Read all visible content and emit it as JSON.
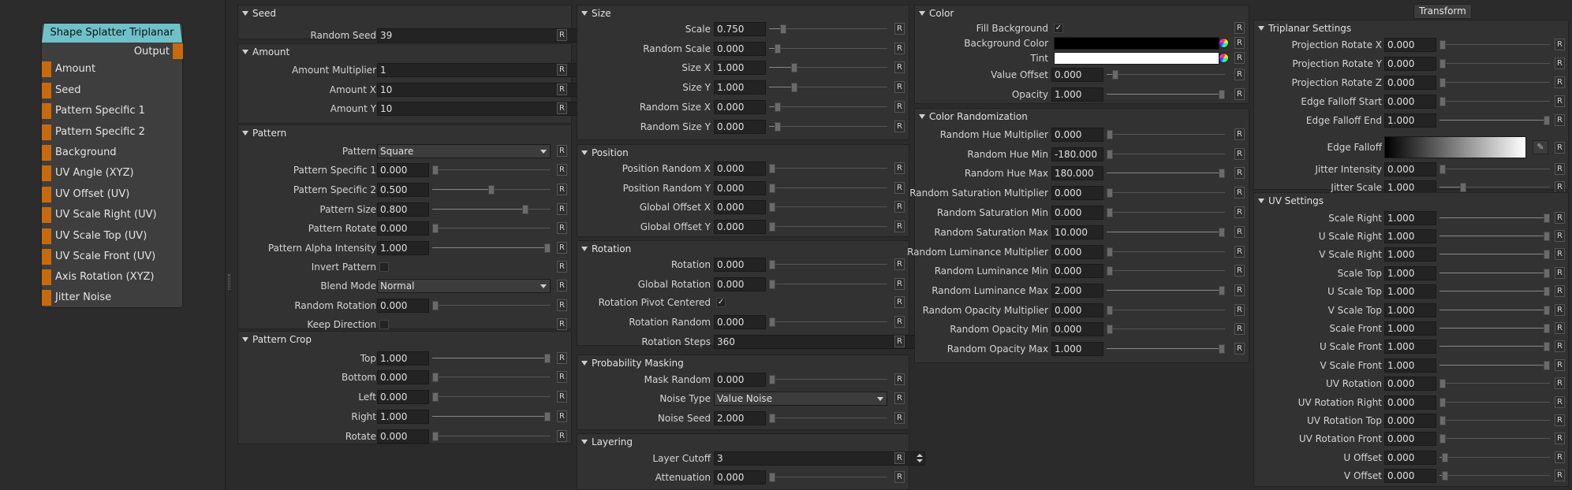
{
  "node": {
    "title": "Shape Splatter Triplanar",
    "output": "Output",
    "inputs": [
      "Amount",
      "Seed",
      "Pattern Specific 1",
      "Pattern Specific 2",
      "Background",
      "UV Angle (XYZ)",
      "UV Offset (UV)",
      "UV Scale Right (UV)",
      "UV Scale Top (UV)",
      "UV Scale Front (UV)",
      "Axis Rotation (XYZ)",
      "Jitter Noise"
    ]
  },
  "reset_label": "R",
  "check_mark": "✓",
  "edit_icon": "✎",
  "transform_tab": "Transform",
  "colors": {
    "node_header": "#6ec1c9",
    "port": "#c86a0c",
    "background_color": "#000000",
    "tint": "#ffffff"
  },
  "panels": [
    {
      "id": "seed",
      "title": "Seed",
      "rows": [
        {
          "label": "Random Seed",
          "type": "spin",
          "value": "39"
        }
      ]
    },
    {
      "id": "amount",
      "title": "Amount",
      "rows": [
        {
          "label": "Amount Multiplier",
          "type": "spin",
          "value": "1"
        },
        {
          "label": "Amount X",
          "type": "spin",
          "value": "10"
        },
        {
          "label": "Amount Y",
          "type": "spin",
          "value": "10"
        }
      ]
    },
    {
      "id": "pattern",
      "title": "Pattern",
      "rows": [
        {
          "label": "Pattern",
          "type": "dropdown",
          "value": "Square"
        },
        {
          "label": "Pattern Specific 1",
          "type": "slider",
          "value": "0.000",
          "level": 0
        },
        {
          "label": "Pattern Specific 2",
          "type": "slider",
          "value": "0.500",
          "level": 0.5
        },
        {
          "label": "Pattern Size",
          "type": "slider",
          "value": "0.800",
          "level": 0.8
        },
        {
          "label": "Pattern Rotate",
          "type": "slider",
          "value": "0.000",
          "level": 0
        },
        {
          "label": "Pattern Alpha Intensity",
          "type": "slider",
          "value": "1.000",
          "level": 1
        },
        {
          "label": "Invert Pattern",
          "type": "check",
          "checked": false
        },
        {
          "label": "Blend Mode",
          "type": "dropdown",
          "value": "Normal"
        },
        {
          "label": "Random Rotation",
          "type": "slider",
          "value": "0.000",
          "level": 0
        },
        {
          "label": "Keep Direction",
          "type": "check",
          "checked": false
        }
      ]
    },
    {
      "id": "pattern-crop",
      "title": "Pattern Crop",
      "rows": [
        {
          "label": "Top",
          "type": "slider",
          "value": "1.000",
          "level": 1
        },
        {
          "label": "Bottom",
          "type": "slider",
          "value": "0.000",
          "level": 0
        },
        {
          "label": "Left",
          "type": "slider",
          "value": "0.000",
          "level": 0
        },
        {
          "label": "Right",
          "type": "slider",
          "value": "1.000",
          "level": 1
        },
        {
          "label": "Rotate",
          "type": "slider",
          "value": "0.000",
          "level": 0
        }
      ]
    },
    {
      "id": "size",
      "title": "Size",
      "rows": [
        {
          "label": "Scale",
          "type": "slider",
          "value": "0.750",
          "level": 0.1
        },
        {
          "label": "Random Scale",
          "type": "slider",
          "value": "0.000",
          "level": 0.05
        },
        {
          "label": "Size X",
          "type": "slider",
          "value": "1.000",
          "level": 0.2
        },
        {
          "label": "Size Y",
          "type": "slider",
          "value": "1.000",
          "level": 0.2
        },
        {
          "label": "Random Size X",
          "type": "slider",
          "value": "0.000",
          "level": 0.05
        },
        {
          "label": "Random Size Y",
          "type": "slider",
          "value": "0.000",
          "level": 0.05
        }
      ]
    },
    {
      "id": "position",
      "title": "Position",
      "rows": [
        {
          "label": "Position Random X",
          "type": "slider",
          "value": "0.000",
          "level": 0
        },
        {
          "label": "Position Random Y",
          "type": "slider",
          "value": "0.000",
          "level": 0
        },
        {
          "label": "Global Offset X",
          "type": "slider",
          "value": "0.000",
          "level": 0
        },
        {
          "label": "Global Offset Y",
          "type": "slider",
          "value": "0.000",
          "level": 0
        }
      ]
    },
    {
      "id": "rotation",
      "title": "Rotation",
      "rows": [
        {
          "label": "Rotation",
          "type": "slider",
          "value": "0.000",
          "level": 0
        },
        {
          "label": "Global Rotation",
          "type": "slider",
          "value": "0.000",
          "level": 0
        },
        {
          "label": "Rotation Pivot Centered",
          "type": "check",
          "checked": true
        },
        {
          "label": "Rotation Random",
          "type": "slider",
          "value": "0.000",
          "level": 0
        },
        {
          "label": "Rotation Steps",
          "type": "spin",
          "value": "360"
        }
      ]
    },
    {
      "id": "probability",
      "title": "Probability Masking",
      "rows": [
        {
          "label": "Mask Random",
          "type": "slider",
          "value": "0.000",
          "level": 0
        },
        {
          "label": "Noise Type",
          "type": "dropdown",
          "value": "Value Noise"
        },
        {
          "label": "Noise Seed",
          "type": "slider",
          "value": "2.000",
          "level": 0
        }
      ]
    },
    {
      "id": "layering",
      "title": "Layering",
      "rows": [
        {
          "label": "Layer Cutoff",
          "type": "spin",
          "value": "3"
        },
        {
          "label": "Attenuation",
          "type": "slider",
          "value": "0.000",
          "level": 0
        }
      ]
    },
    {
      "id": "color",
      "title": "Color",
      "rows": [
        {
          "label": "Fill Background",
          "type": "check",
          "checked": true
        },
        {
          "label": "Background Color",
          "type": "color",
          "color": "#000000"
        },
        {
          "label": "Tint",
          "type": "color",
          "color": "#ffffff"
        },
        {
          "label": "Value Offset",
          "type": "slider",
          "value": "0.000",
          "level": 0.05
        },
        {
          "label": "Opacity",
          "type": "slider",
          "value": "1.000",
          "level": 1
        }
      ]
    },
    {
      "id": "color-rand",
      "title": "Color Randomization",
      "rows": [
        {
          "label": "Random Hue Multiplier",
          "type": "slider",
          "value": "0.000",
          "level": 0
        },
        {
          "label": "Random Hue Min",
          "type": "slider",
          "value": "-180.000",
          "level": 0
        },
        {
          "label": "Random Hue Max",
          "type": "slider",
          "value": "180.000",
          "level": 1
        },
        {
          "label": "Random Saturation Multiplier",
          "type": "slider",
          "value": "0.000",
          "level": 0
        },
        {
          "label": "Random Saturation Min",
          "type": "slider",
          "value": "0.000",
          "level": 0
        },
        {
          "label": "Random Saturation Max",
          "type": "slider",
          "value": "10.000",
          "level": 1
        },
        {
          "label": "Random Luminance Multiplier",
          "type": "slider",
          "value": "0.000",
          "level": 0
        },
        {
          "label": "Random Luminance Min",
          "type": "slider",
          "value": "0.000",
          "level": 0
        },
        {
          "label": "Random Luminance Max",
          "type": "slider",
          "value": "2.000",
          "level": 1
        },
        {
          "label": "Random Opacity Multiplier",
          "type": "slider",
          "value": "0.000",
          "level": 0
        },
        {
          "label": "Random Opacity Min",
          "type": "slider",
          "value": "0.000",
          "level": 0
        },
        {
          "label": "Random Opacity Max",
          "type": "slider",
          "value": "1.000",
          "level": 1
        }
      ]
    },
    {
      "id": "triplanar",
      "title": "Triplanar Settings",
      "rows": [
        {
          "label": "Projection Rotate X",
          "type": "slider",
          "value": "0.000",
          "level": 0
        },
        {
          "label": "Projection Rotate Y",
          "type": "slider",
          "value": "0.000",
          "level": 0
        },
        {
          "label": "Projection Rotate Z",
          "type": "slider",
          "value": "0.000",
          "level": 0
        },
        {
          "label": "Edge Falloff Start",
          "type": "slider",
          "value": "0.000",
          "level": 0
        },
        {
          "label": "Edge Falloff End",
          "type": "slider",
          "value": "1.000",
          "level": 1
        },
        {
          "label": "Edge Falloff",
          "type": "gradient"
        },
        {
          "label": "Jitter Intensity",
          "type": "slider",
          "value": "0.000",
          "level": 0
        },
        {
          "label": "Jitter Scale",
          "type": "slider",
          "value": "1.000",
          "level": 0.2
        }
      ]
    },
    {
      "id": "uv",
      "title": "UV Settings",
      "rows": [
        {
          "label": "Scale Right",
          "type": "slider",
          "value": "1.000",
          "level": 1
        },
        {
          "label": "U Scale Right",
          "type": "slider",
          "value": "1.000",
          "level": 1
        },
        {
          "label": "V Scale Right",
          "type": "slider",
          "value": "1.000",
          "level": 1
        },
        {
          "label": "Scale Top",
          "type": "slider",
          "value": "1.000",
          "level": 1
        },
        {
          "label": "U Scale Top",
          "type": "slider",
          "value": "1.000",
          "level": 1
        },
        {
          "label": "V Scale Top",
          "type": "slider",
          "value": "1.000",
          "level": 1
        },
        {
          "label": "Scale Front",
          "type": "slider",
          "value": "1.000",
          "level": 1
        },
        {
          "label": "U Scale Front",
          "type": "slider",
          "value": "1.000",
          "level": 1
        },
        {
          "label": "V Scale Front",
          "type": "slider",
          "value": "1.000",
          "level": 1
        },
        {
          "label": "UV Rotation",
          "type": "slider",
          "value": "0.000",
          "level": 0
        },
        {
          "label": "UV Rotation Right",
          "type": "slider",
          "value": "0.000",
          "level": 0
        },
        {
          "label": "UV Rotation Top",
          "type": "slider",
          "value": "0.000",
          "level": 0
        },
        {
          "label": "UV Rotation Front",
          "type": "slider",
          "value": "0.000",
          "level": 0
        },
        {
          "label": "U Offset",
          "type": "slider",
          "value": "0.000",
          "level": 0.02
        },
        {
          "label": "V Offset",
          "type": "slider",
          "value": "0.000",
          "level": 0.02
        }
      ]
    }
  ]
}
